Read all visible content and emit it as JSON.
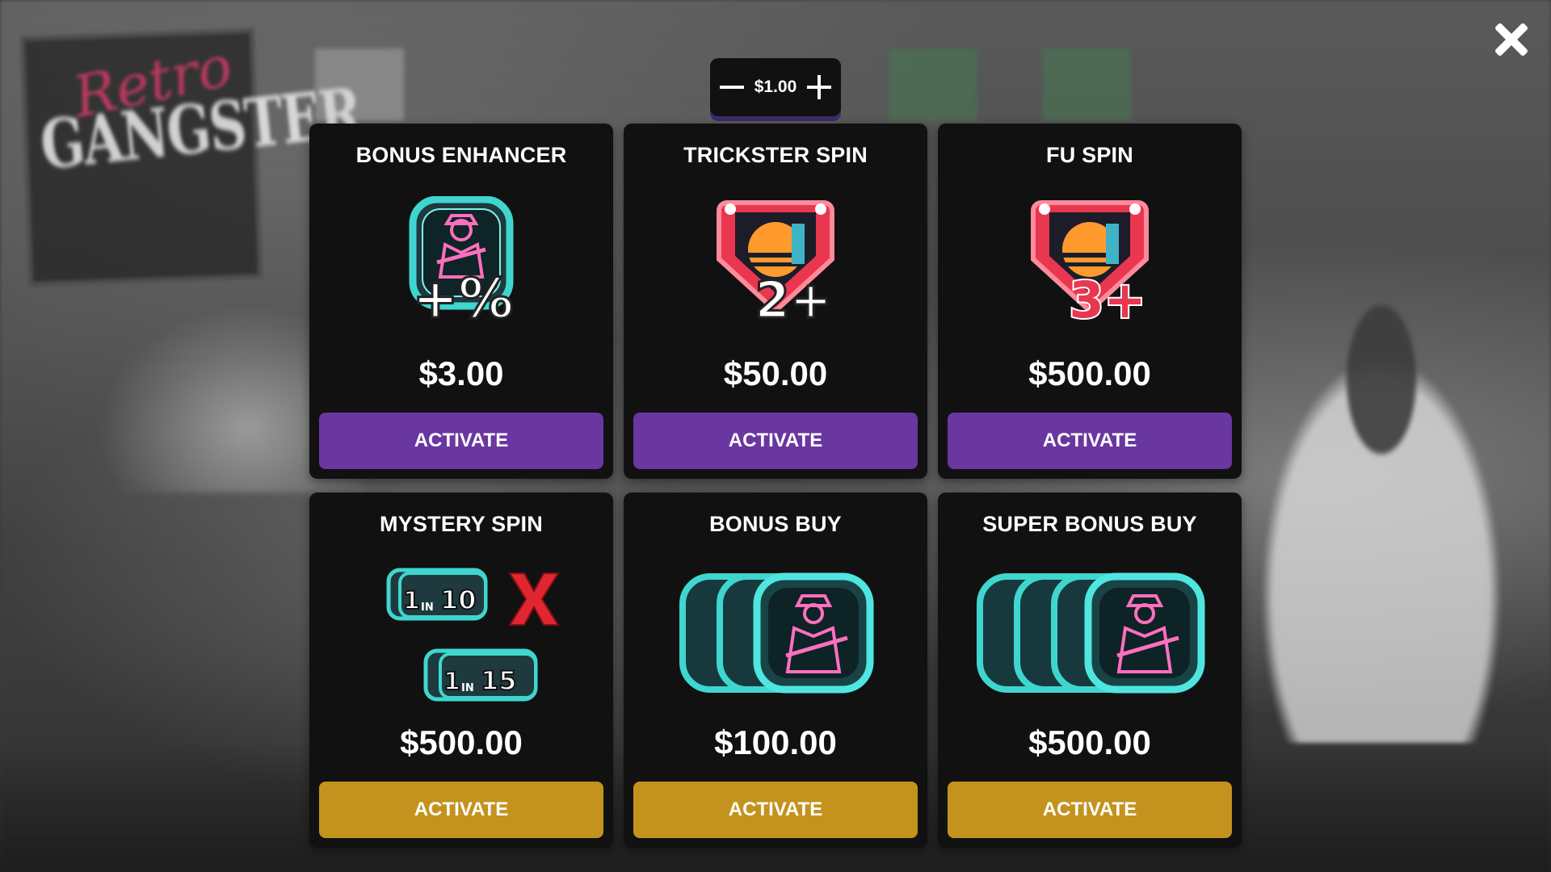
{
  "stepper": {
    "value": "$1.00"
  },
  "cards": [
    {
      "title": "BONUS ENHANCER",
      "price": "$3.00",
      "button": "ACTIVATE",
      "button_color": "#6a36a0",
      "icon": "percent-badge-icon",
      "icon_text": "+%"
    },
    {
      "title": "TRICKSTER SPIN",
      "price": "$50.00",
      "button": "ACTIVATE",
      "button_color": "#6a36a0",
      "icon": "sunset-shield-icon",
      "icon_text": "2+"
    },
    {
      "title": "FU SPIN",
      "price": "$500.00",
      "button": "ACTIVATE",
      "button_color": "#6a36a0",
      "icon": "sunset-shield-icon",
      "icon_text": "3+"
    },
    {
      "title": "MYSTERY SPIN",
      "price": "$500.00",
      "button": "ACTIVATE",
      "button_color": "#c3931e",
      "icon": "mystery-odds-icon",
      "odds": [
        "1",
        "IN",
        "10",
        "1",
        "IN",
        "15"
      ]
    },
    {
      "title": "BONUS BUY",
      "price": "$100.00",
      "button": "ACTIVATE",
      "button_color": "#c3931e",
      "icon": "gangster-cards-3-icon"
    },
    {
      "title": "SUPER BONUS BUY",
      "price": "$500.00",
      "button": "ACTIVATE",
      "button_color": "#c3931e",
      "icon": "gangster-cards-4-icon"
    }
  ],
  "background": {
    "sign_left_script": "Retro",
    "sign_left_main": "GANGSTER"
  }
}
